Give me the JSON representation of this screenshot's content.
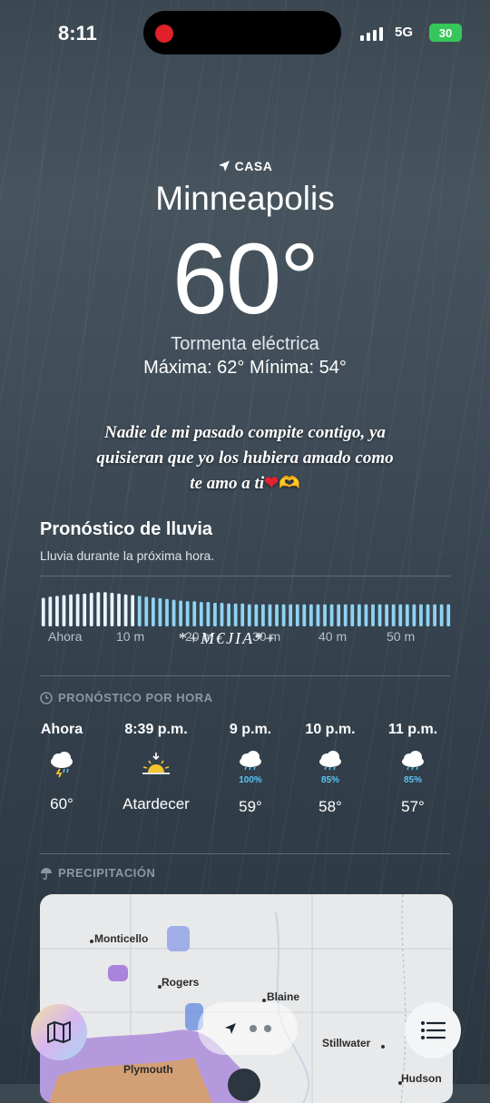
{
  "status": {
    "time": "8:11",
    "network": "5G",
    "battery": "30"
  },
  "location": {
    "tag": "CASA",
    "city": "Minneapolis",
    "temperature": "60°",
    "condition": "Tormenta eléctrica",
    "hilo": "Máxima: 62°  Mínima: 54°"
  },
  "overlay": {
    "text": "Nadie de mi pasado compite contigo, ya quisieran que yo los hubiera amado como te amo a ti",
    "watermark": "*+M€JIA*+"
  },
  "rain_forecast": {
    "title": "Pronóstico de lluvia",
    "subtitle": "Lluvia durante la próxima hora.",
    "time_labels": [
      "Ahora",
      "10 m",
      "20 m",
      "30 m",
      "40 m",
      "50 m"
    ],
    "intensity": [
      0.75,
      0.78,
      0.8,
      0.82,
      0.84,
      0.85,
      0.86,
      0.88,
      0.9,
      0.9,
      0.88,
      0.86,
      0.84,
      0.82,
      0.8,
      0.78,
      0.76,
      0.74,
      0.72,
      0.7,
      0.68,
      0.66,
      0.66,
      0.64,
      0.64,
      0.62,
      0.62,
      0.6,
      0.6,
      0.6,
      0.58,
      0.58,
      0.58,
      0.58,
      0.58,
      0.58,
      0.58,
      0.58,
      0.58,
      0.58,
      0.58,
      0.58,
      0.58,
      0.58,
      0.58,
      0.58,
      0.58,
      0.58,
      0.58,
      0.58,
      0.58,
      0.58,
      0.58,
      0.58,
      0.58,
      0.58,
      0.58,
      0.58,
      0.58,
      0.58
    ]
  },
  "hourly": {
    "header": "PRONÓSTICO POR HORA",
    "items": [
      {
        "label": "Ahora",
        "icon": "thunderstorm-icon",
        "precip": "",
        "temp": "60°"
      },
      {
        "label": "8:39 p.m.",
        "icon": "sunset-icon",
        "precip": "",
        "temp": "Atardecer"
      },
      {
        "label": "9 p.m.",
        "icon": "rain-cloud-icon",
        "precip": "100%",
        "temp": "59°"
      },
      {
        "label": "10 p.m.",
        "icon": "rain-cloud-icon",
        "precip": "85%",
        "temp": "58°"
      },
      {
        "label": "11 p.m.",
        "icon": "rain-cloud-icon",
        "precip": "85%",
        "temp": "57°"
      }
    ]
  },
  "precipitation": {
    "header": "PRECIPITACIÓN",
    "map_labels": [
      "Monticello",
      "Rogers",
      "Blaine",
      "Stillwater",
      "Plymouth",
      "Hudson"
    ]
  },
  "colors": {
    "accent_blue": "#5cc4f2",
    "battery_green": "#35c759",
    "record_red": "#e0202a"
  }
}
